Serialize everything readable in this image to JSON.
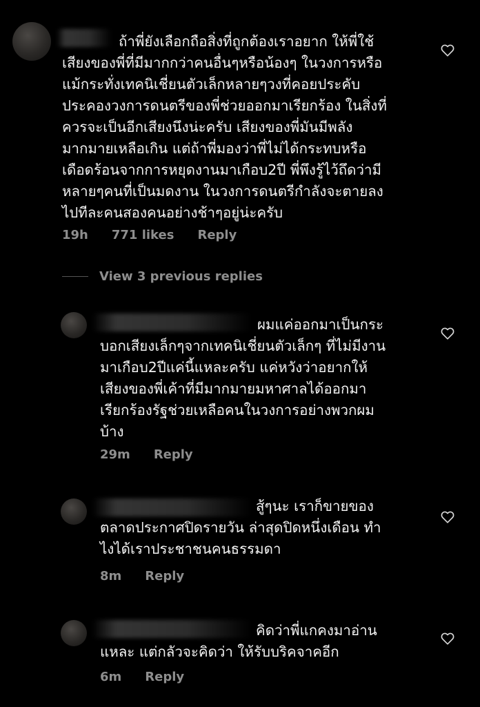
{
  "colors": {
    "background": "#000000",
    "text": "#f2f2f2",
    "meta": "#8e8e8e"
  },
  "comments": [
    {
      "text": "ถ้าพี่ยังเลือกถือสิ่งที่ถูกต้องเราอยาก ให้พี่ใช้\nเสียงของพี่ที่มีมากกว่าคนอื่นๆหรือน้องๆ ในวงการหรือ\nแม้กระทั่งเทคนิเชี่ยนตัวเล็กหลายๆวงที่คอยประคับ\nประคองวงการดนตรีของพี่ช่วยออกมาเรียกร้อง ในสิ่งที่\nควรจะเป็นอีกเสียงนึงน่ะครับ เสียงของพี่มันมีพลัง\nมากมายเหลือเกิน แต่ถ้าพี่มองว่าพี่ไม่ได้กระทบหรือ\nเดือดร้อนจากการหยุดงานมาเกือบ2ปี พี่พึงรู้ไว้ถึดว่ามี\nหลายๆคนที่เป็นมดงาน ในวงการดนตรีกำลังจะตายลง\nไปทีละคนสองคนอย่างช้าๆอยู่น่ะครับ",
      "time": "19h",
      "likes": "771 likes",
      "reply": "Reply",
      "heart_icon": "heart-outline-icon"
    },
    {
      "text": "ผมแค่ออกมาเป็นกระ\nบอกเสียงเล็กๆจากเทคนิเชี่ยนตัวเล็กๆ ที่ไม่มีงาน\nมาเกือบ2ปีแค่นี้แหละครับ แค่หวังว่าอยากให้\nเสียงของพี่เค้าที่มีมากมายมหาศาลได้ออกมา\nเรียกร้องรัฐช่วยเหลือคนในวงการอย่างพวกผม\nบ้าง",
      "time": "29m",
      "reply": "Reply",
      "heart_icon": "heart-outline-icon"
    },
    {
      "text": "สู้ๆนะ เราก็ขายของ\nตลาดประกาศปิดรายวัน ล่าสุดปิดหนึ่งเดือน ทำ\nไงได้เราประชาชนคนธรรมดา",
      "time": "8m",
      "reply": "Reply",
      "heart_icon": "heart-outline-icon"
    },
    {
      "text": "คิดว่าพี่แกคงมาอ่าน\nแหละ แต่กลัวจะคิดว่า ให้รับบริคจาคอีก",
      "time": "6m",
      "reply": "Reply",
      "heart_icon": "heart-outline-icon"
    }
  ],
  "view_replies": {
    "label": "View 3 previous replies"
  }
}
